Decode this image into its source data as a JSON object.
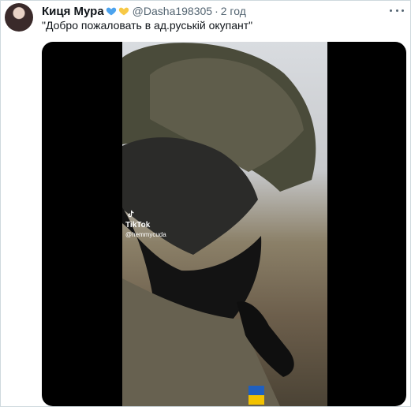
{
  "user": {
    "name": "Киця Мура",
    "handle": "@Dasha198305",
    "time": "2 год"
  },
  "tweet": {
    "text": "\"Добро пожаловать в ад.руській окупант\""
  },
  "media": {
    "watermark_brand": "TikTok",
    "watermark_user": "@hemmycuda"
  },
  "icons": {
    "heart1": "blue-heart-icon",
    "heart2": "yellow-heart-icon",
    "more": "more-icon",
    "tiktok": "tiktok-logo-icon"
  },
  "colors": {
    "text": "#0f1419",
    "secondary": "#536471",
    "heart_blue": "#4ca3ee",
    "heart_yellow": "#f7c946"
  }
}
